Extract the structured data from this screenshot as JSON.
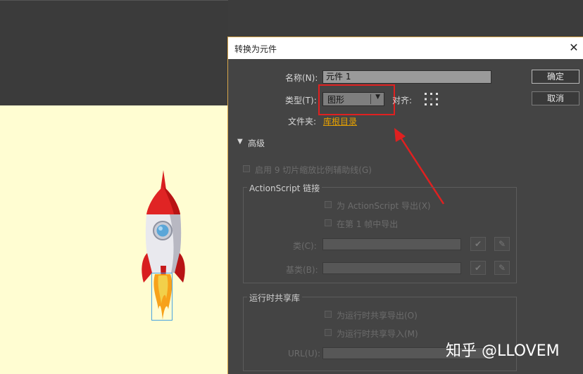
{
  "dialog": {
    "title": "转换为元件",
    "close_glyph": "✕",
    "name_label": "名称(N):",
    "name_value": "元件 1",
    "type_label": "类型(T):",
    "type_value": "图形",
    "align_label": "对齐:",
    "folder_label": "文件夹:",
    "folder_value": "库根目录",
    "ok_button": "确定",
    "cancel_button": "取消",
    "advanced_toggle": "▼",
    "advanced_label": "高级",
    "nine_slice_label": "启用 9 切片缩放比例辅助线(G)",
    "actionscript": {
      "title": "ActionScript 链接",
      "export_as": "为 ActionScript 导出(X)",
      "export_frame1": "在第 1 帧中导出",
      "class_label": "类(C):",
      "base_class_label": "基类(B):",
      "check_glyph": "✔",
      "edit_glyph": "✎"
    },
    "runtime": {
      "title": "运行时共享库",
      "export_runtime": "为运行时共享导出(O)",
      "import_runtime": "为运行时共享导入(M)",
      "url_label": "URL(U):"
    }
  },
  "watermark": "知乎 @LLOVEM",
  "colors": {
    "stage": "#fffdd2",
    "dialog_bg": "#444444",
    "highlight": "#e02020",
    "link": "#e8a200",
    "selection": "#4aa3df"
  }
}
